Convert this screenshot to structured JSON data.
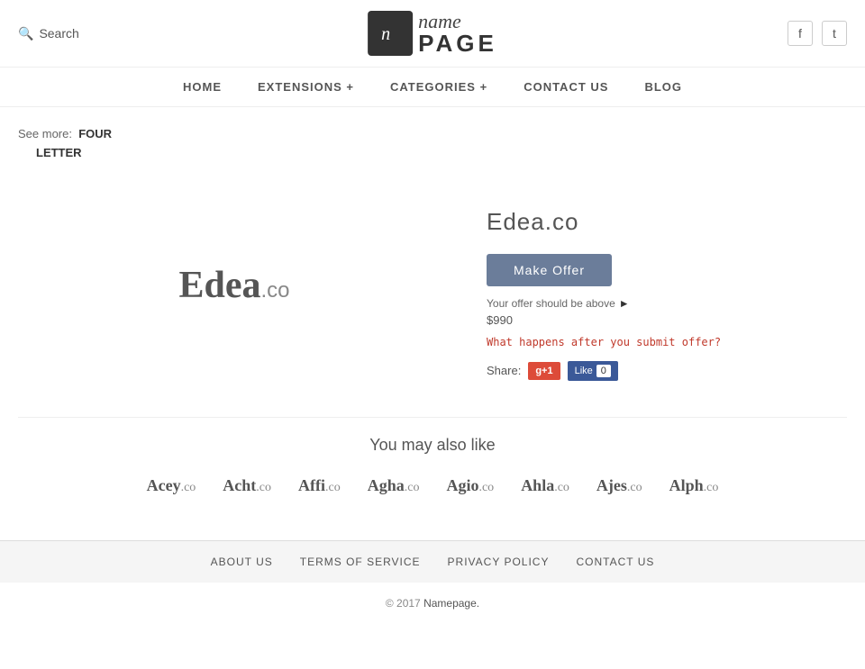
{
  "header": {
    "search_placeholder": "Search",
    "logo_name": "name",
    "logo_page": "PAGE",
    "social": [
      {
        "name": "facebook",
        "icon": "f"
      },
      {
        "name": "twitter",
        "icon": "t"
      }
    ]
  },
  "nav": {
    "items": [
      {
        "label": "HOME",
        "id": "home"
      },
      {
        "label": "EXTENSIONS +",
        "id": "extensions"
      },
      {
        "label": "CATEGORIES +",
        "id": "categories"
      },
      {
        "label": "CONTACT US",
        "id": "contact"
      },
      {
        "label": "BLOG",
        "id": "blog"
      }
    ]
  },
  "breadcrumb": {
    "prefix": "See more:",
    "link1": "FOUR",
    "link2": "LETTER"
  },
  "domain": {
    "name": "Edea",
    "ext": ".co",
    "full": "Edea.co",
    "make_offer_label": "Make Offer",
    "offer_hint": "Your offer should be above",
    "offer_amount": "$990",
    "what_happens": "What happens after you submit offer?",
    "share_label": "Share:",
    "gplus_label": "g+1",
    "fb_label": "Like",
    "fb_count": "0"
  },
  "also_like": {
    "title": "You may also like",
    "domains": [
      {
        "name": "Acey",
        "ext": ".co"
      },
      {
        "name": "Acht",
        "ext": ".co"
      },
      {
        "name": "Affi",
        "ext": ".co"
      },
      {
        "name": "Agha",
        "ext": ".co"
      },
      {
        "name": "Agio",
        "ext": ".co"
      },
      {
        "name": "Ahla",
        "ext": ".co"
      },
      {
        "name": "Ajes",
        "ext": ".co"
      },
      {
        "name": "Alph",
        "ext": ".co"
      }
    ]
  },
  "footer": {
    "links": [
      {
        "label": "ABOUT US",
        "id": "about"
      },
      {
        "label": "TERMS OF SERVICE",
        "id": "terms"
      },
      {
        "label": "PRIVACY POLICY",
        "id": "privacy"
      },
      {
        "label": "CONTACT US",
        "id": "contact"
      }
    ],
    "copy": "© 2017",
    "copy_brand": "Namepage."
  }
}
